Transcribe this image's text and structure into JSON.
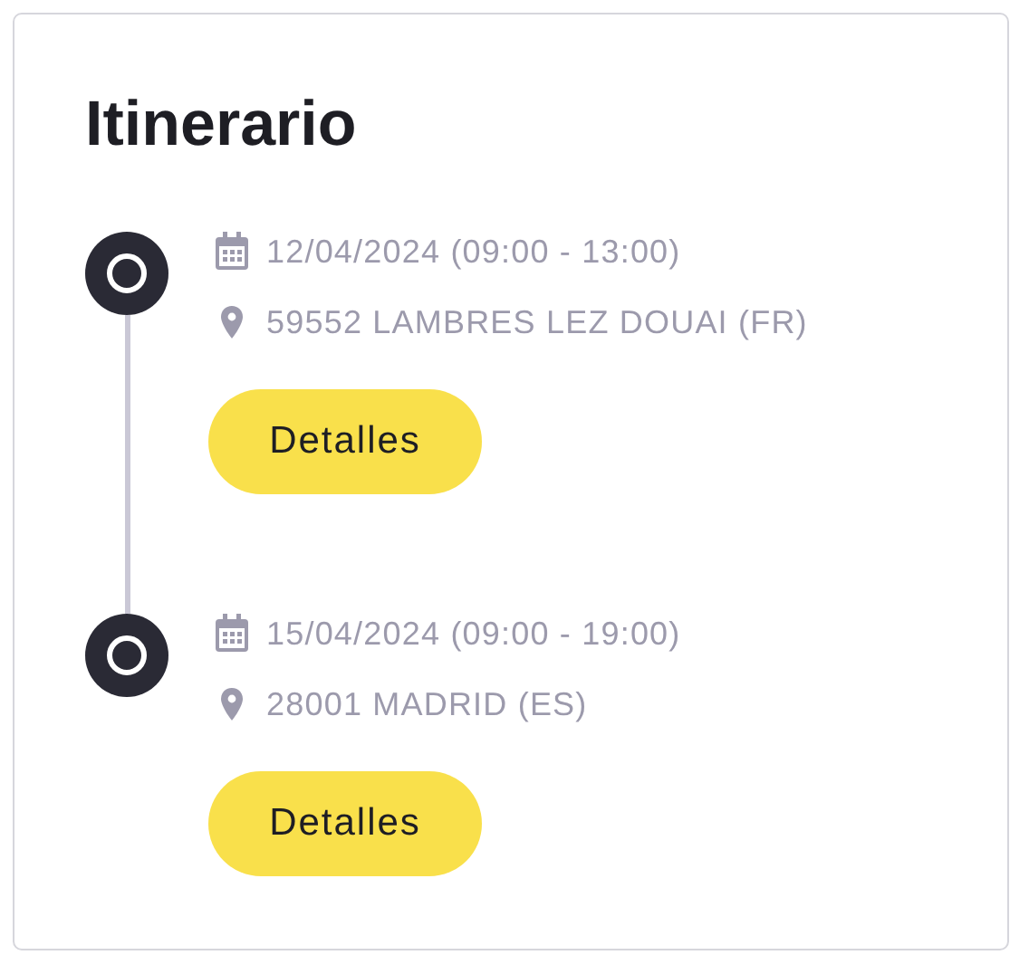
{
  "title": "Itinerario",
  "stops": [
    {
      "date": "12/04/2024 (09:00 - 13:00)",
      "location": "59552 LAMBRES LEZ DOUAI (FR)",
      "button": "Detalles"
    },
    {
      "date": "15/04/2024 (09:00 - 19:00)",
      "location": "28001 MADRID (ES)",
      "button": "Detalles"
    }
  ]
}
